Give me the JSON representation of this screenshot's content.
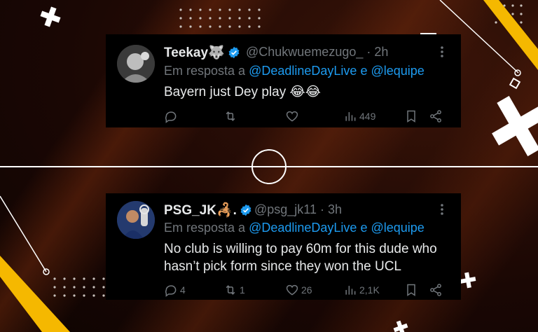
{
  "tweets": [
    {
      "name": "Teekay🐺",
      "handle": "@Chukwuemezugo_",
      "time": "· 2h",
      "reply_prefix": "Em resposta a",
      "reply_mention1": "@DeadlineDayLive",
      "reply_and": "e",
      "reply_mention2": "@lequipe",
      "text": "Bayern just Dey play 😂😂",
      "replies": "",
      "retweets": "",
      "likes": "",
      "views": "449"
    },
    {
      "name": "PSG_JK🦂.",
      "handle": "@psg_jk11",
      "time": "· 3h",
      "reply_prefix": "Em resposta a",
      "reply_mention1": "@DeadlineDayLive",
      "reply_and": "e",
      "reply_mention2": "@lequipe",
      "text": "No club is willing to pay 60m for this dude who hasn’t pick form since they won the UCL",
      "replies": "4",
      "retweets": "1",
      "likes": "26",
      "views": "2,1K"
    }
  ],
  "colors": {
    "accent_yellow": "#f5b800",
    "link_blue": "#1d9bf0",
    "muted": "#71767b",
    "text": "#e7e9ea",
    "card_bg": "#000000"
  },
  "icons": [
    "reply-icon",
    "retweet-icon",
    "like-icon",
    "views-icon",
    "bookmark-icon",
    "share-icon",
    "more-icon",
    "verified-badge-icon"
  ]
}
